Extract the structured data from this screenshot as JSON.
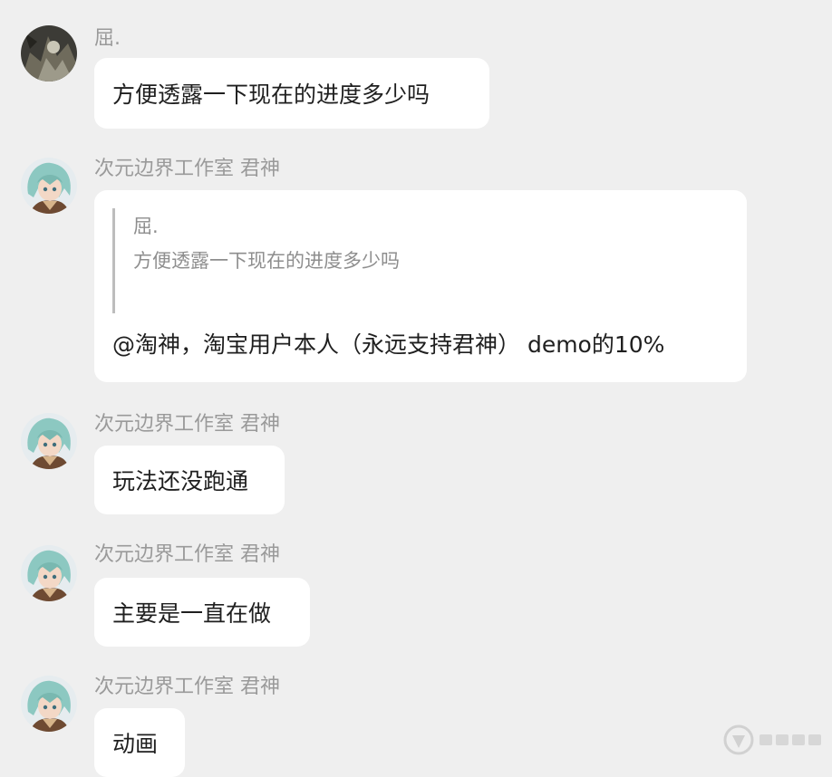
{
  "messages": [
    {
      "sender": "屈.",
      "avatar": "dark-user-avatar",
      "text": "方便透露一下现在的进度多少吗"
    },
    {
      "sender": "次元边界工作室 君神",
      "avatar": "anime-character-avatar",
      "quote": {
        "sender": "屈.",
        "text": "方便透露一下现在的进度多少吗"
      },
      "text": "@淘神，淘宝用户本人（永远支持君神） demo的10%"
    },
    {
      "sender": "次元边界工作室 君神",
      "avatar": "anime-character-avatar",
      "text": "玩法还没跑通"
    },
    {
      "sender": "次元边界工作室 君神",
      "avatar": "anime-character-avatar",
      "text": "主要是一直在做"
    },
    {
      "sender": "次元边界工作室 君神",
      "avatar": "anime-character-avatar",
      "text": "动画"
    }
  ],
  "colors": {
    "background": "#efefef",
    "bubble": "#ffffff",
    "sender": "#9a9a9a",
    "text": "#1f1f1f"
  },
  "watermark": {
    "icon": "site-logo-icon"
  }
}
